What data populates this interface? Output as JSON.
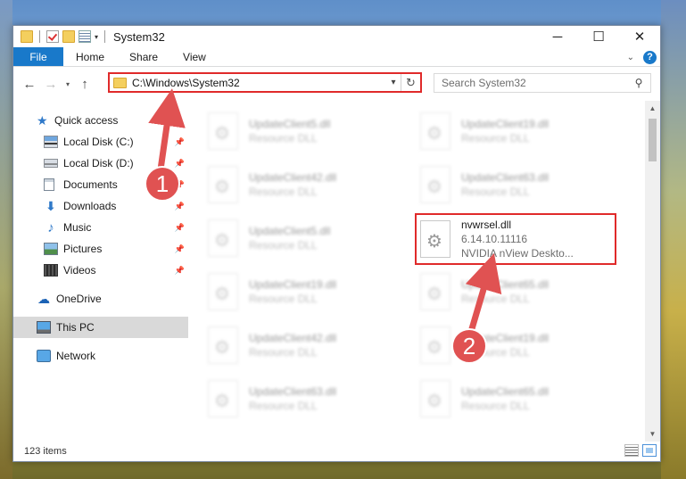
{
  "window": {
    "title": "System32",
    "min": "─",
    "max": "☐",
    "close": "✕"
  },
  "ribbon": {
    "file": "File",
    "tabs": [
      "Home",
      "Share",
      "View"
    ],
    "help": "?"
  },
  "nav": {
    "back": "←",
    "forward": "→",
    "recent": "▾",
    "up": "↑",
    "address": "C:\\Windows\\System32",
    "address_dd": "▾",
    "refresh": "↻",
    "search_placeholder": "Search System32",
    "search_icon": "⚲"
  },
  "sidebar": {
    "quick_access": "Quick access",
    "items": [
      {
        "label": "Local Disk (C:)",
        "icon": "drive-icon",
        "pinned": true
      },
      {
        "label": "Local Disk (D:)",
        "icon": "drive-icon",
        "pinned": true
      },
      {
        "label": "Documents",
        "icon": "documents-icon",
        "pinned": true
      },
      {
        "label": "Downloads",
        "icon": "downloads-icon",
        "pinned": true
      },
      {
        "label": "Music",
        "icon": "music-icon",
        "pinned": true
      },
      {
        "label": "Pictures",
        "icon": "pictures-icon",
        "pinned": true
      },
      {
        "label": "Videos",
        "icon": "videos-icon",
        "pinned": true
      }
    ],
    "onedrive": "OneDrive",
    "this_pc": "This PC",
    "network": "Network",
    "pin_glyph": "📌"
  },
  "files": {
    "left": [
      {
        "name": "UpdateClient5.dll",
        "type": "Resource DLL"
      },
      {
        "name": "UpdateClient42.dll",
        "type": "Resource DLL"
      },
      {
        "name": "UpdateClient5.dll",
        "type": "Resource DLL"
      },
      {
        "name": "UpdateClient19.dll",
        "type": "Resource DLL"
      },
      {
        "name": "UpdateClient42.dll",
        "type": "Resource DLL"
      },
      {
        "name": "UpdateClient63.dll",
        "type": "Resource DLL"
      }
    ],
    "right": [
      {
        "name": "UpdateClient19.dll",
        "type": "Resource DLL"
      },
      {
        "name": "UpdateClient63.dll",
        "type": "Resource DLL"
      },
      {
        "name": "UpdateClient65.dll",
        "type": "Resource DLL"
      },
      {
        "name": "UpdateClient19.dll",
        "type": "Resource DLL"
      },
      {
        "name": "UpdateClient65.dll",
        "type": "Resource DLL"
      }
    ],
    "highlighted": {
      "name": "nvwrsel.dll",
      "version": "6.14.10.11116",
      "description": "NVIDIA nView Deskto..."
    }
  },
  "status": {
    "count": "123 items"
  },
  "annotations": {
    "step1": "1",
    "step2": "2",
    "color": "#e05252"
  }
}
